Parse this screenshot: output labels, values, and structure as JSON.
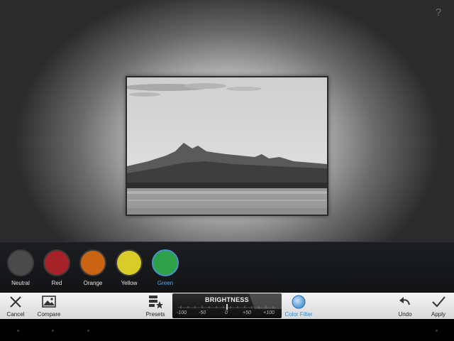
{
  "help": {
    "label": "?"
  },
  "filters": [
    {
      "label": "Neutral",
      "color": "#4a4a4a",
      "selected": false
    },
    {
      "label": "Red",
      "color": "#a52228",
      "selected": false
    },
    {
      "label": "Orange",
      "color": "#c86414",
      "selected": false
    },
    {
      "label": "Yellow",
      "color": "#d9cc2a",
      "selected": false
    },
    {
      "label": "Green",
      "color": "#2ea04a",
      "selected": true
    }
  ],
  "toolbar": {
    "cancel_label": "Cancel",
    "compare_label": "Compare",
    "presets_label": "Presets",
    "color_filter_label": "Color Filter",
    "undo_label": "Undo",
    "apply_label": "Apply"
  },
  "slider": {
    "name": "BRIGHTNESS",
    "ticks": [
      "-100",
      "-50",
      "0",
      "+50",
      "+100"
    ],
    "value": 0
  },
  "colors": {
    "accent": "#3a86c8"
  }
}
